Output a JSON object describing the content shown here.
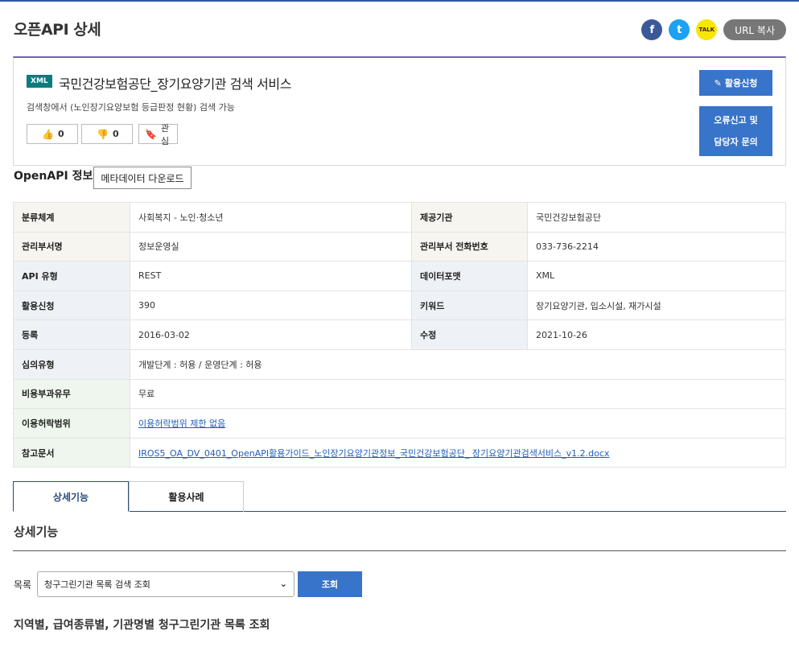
{
  "page": {
    "title": "오픈API 상세"
  },
  "share": {
    "facebook_glyph": "f",
    "twitter_glyph": "t",
    "kakao_glyph": "TALK",
    "url_copy_label": "URL 복사"
  },
  "summary": {
    "format_badge": "XML",
    "title": "국민건강보험공단_장기요양기관 검색 서비스",
    "description": "검색창에서 (노인장기요양보험 등급판정 현황) 검색 가능",
    "like_count": "0",
    "dislike_count": "0",
    "favorite_label": "관심",
    "apply_label": "활용신청",
    "report_label_line1": "오류신고 및",
    "report_label_line2": "담당자 문의"
  },
  "info": {
    "heading": "OpenAPI 정보",
    "metadata_download_label": "메타데이터 다운로드",
    "rows": [
      {
        "k1": "분류체계",
        "v1": "사회복지 - 노인·청소년",
        "k2": "제공기관",
        "v2": "국민건강보험공단"
      },
      {
        "k1": "관리부서명",
        "v1": "정보운영실",
        "k2": "관리부서 전화번호",
        "v2": "033-736-2214"
      },
      {
        "k1": "API 유형",
        "v1": "REST",
        "k2": "데이터포맷",
        "v2": "XML"
      },
      {
        "k1": "활용신청",
        "v1": "390",
        "k2": "키워드",
        "v2": "장기요양기관, 입소시설, 재가시설"
      },
      {
        "k1": "등록",
        "v1": "2016-03-02",
        "k2": "수정",
        "v2": "2021-10-26"
      }
    ],
    "review_type": {
      "k": "심의유형",
      "v": "개발단계 : 허용 / 운영단계 : 허용"
    },
    "fee": {
      "k": "비용부과유무",
      "v": "무료"
    },
    "license": {
      "k": "이용허락범위",
      "v": "이용허락범위 제한 없음"
    },
    "reference": {
      "k": "참고문서",
      "v": "IROS5_OA_DV_0401_OpenAPI활용가이드_노인장기요양기관정보_국민건강보험공단_ 장기요양기관검색서비스_v1.2.docx"
    }
  },
  "tabs": {
    "detail_label": "상세기능",
    "usecase_label": "활용사례"
  },
  "detail": {
    "section_title": "상세기능",
    "list_label": "목록",
    "selected_operation": "청구그린기관 목록 검색 조회",
    "search_label": "조회",
    "operation_title": "지역별, 급여종류별, 기관명별 청구그린기관 목록 조회"
  }
}
